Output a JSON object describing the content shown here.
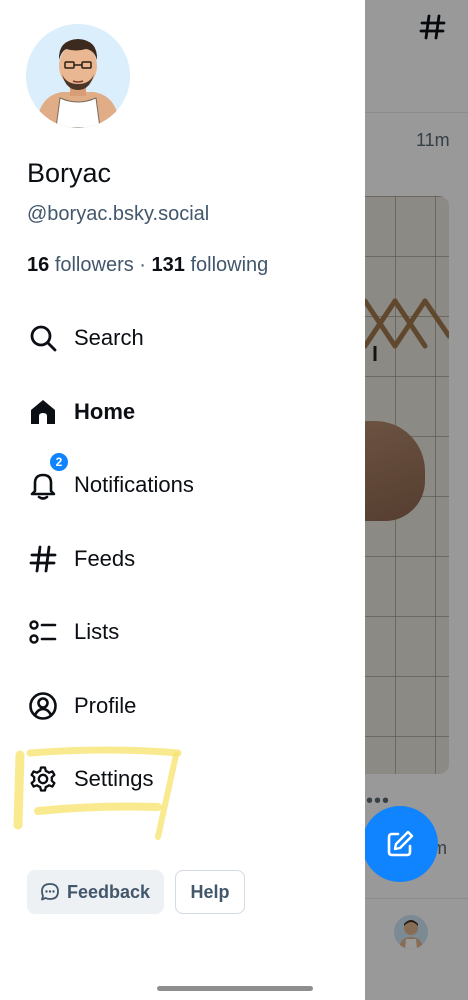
{
  "background_feed": {
    "post_time": "11m",
    "post_time_2": "m",
    "more_dots": "•••"
  },
  "profile": {
    "display_name": "Boryac",
    "handle": "@boryac.bsky.social",
    "followers_count": "16",
    "followers_label": "followers",
    "separator": "·",
    "following_count": "131",
    "following_label": "following"
  },
  "nav": {
    "items": [
      {
        "label": "Search",
        "icon": "search-icon"
      },
      {
        "label": "Home",
        "icon": "home-icon"
      },
      {
        "label": "Notifications",
        "icon": "bell-icon",
        "badge": "2"
      },
      {
        "label": "Feeds",
        "icon": "hash-icon"
      },
      {
        "label": "Lists",
        "icon": "list-icon"
      },
      {
        "label": "Profile",
        "icon": "user-circle-icon"
      },
      {
        "label": "Settings",
        "icon": "gear-icon"
      }
    ]
  },
  "footer": {
    "feedback_label": "Feedback",
    "help_label": "Help"
  },
  "colors": {
    "accent": "#1083fe",
    "text_primary": "#0b0f14",
    "text_secondary": "#42576c",
    "highlight": "#f7e36a"
  }
}
